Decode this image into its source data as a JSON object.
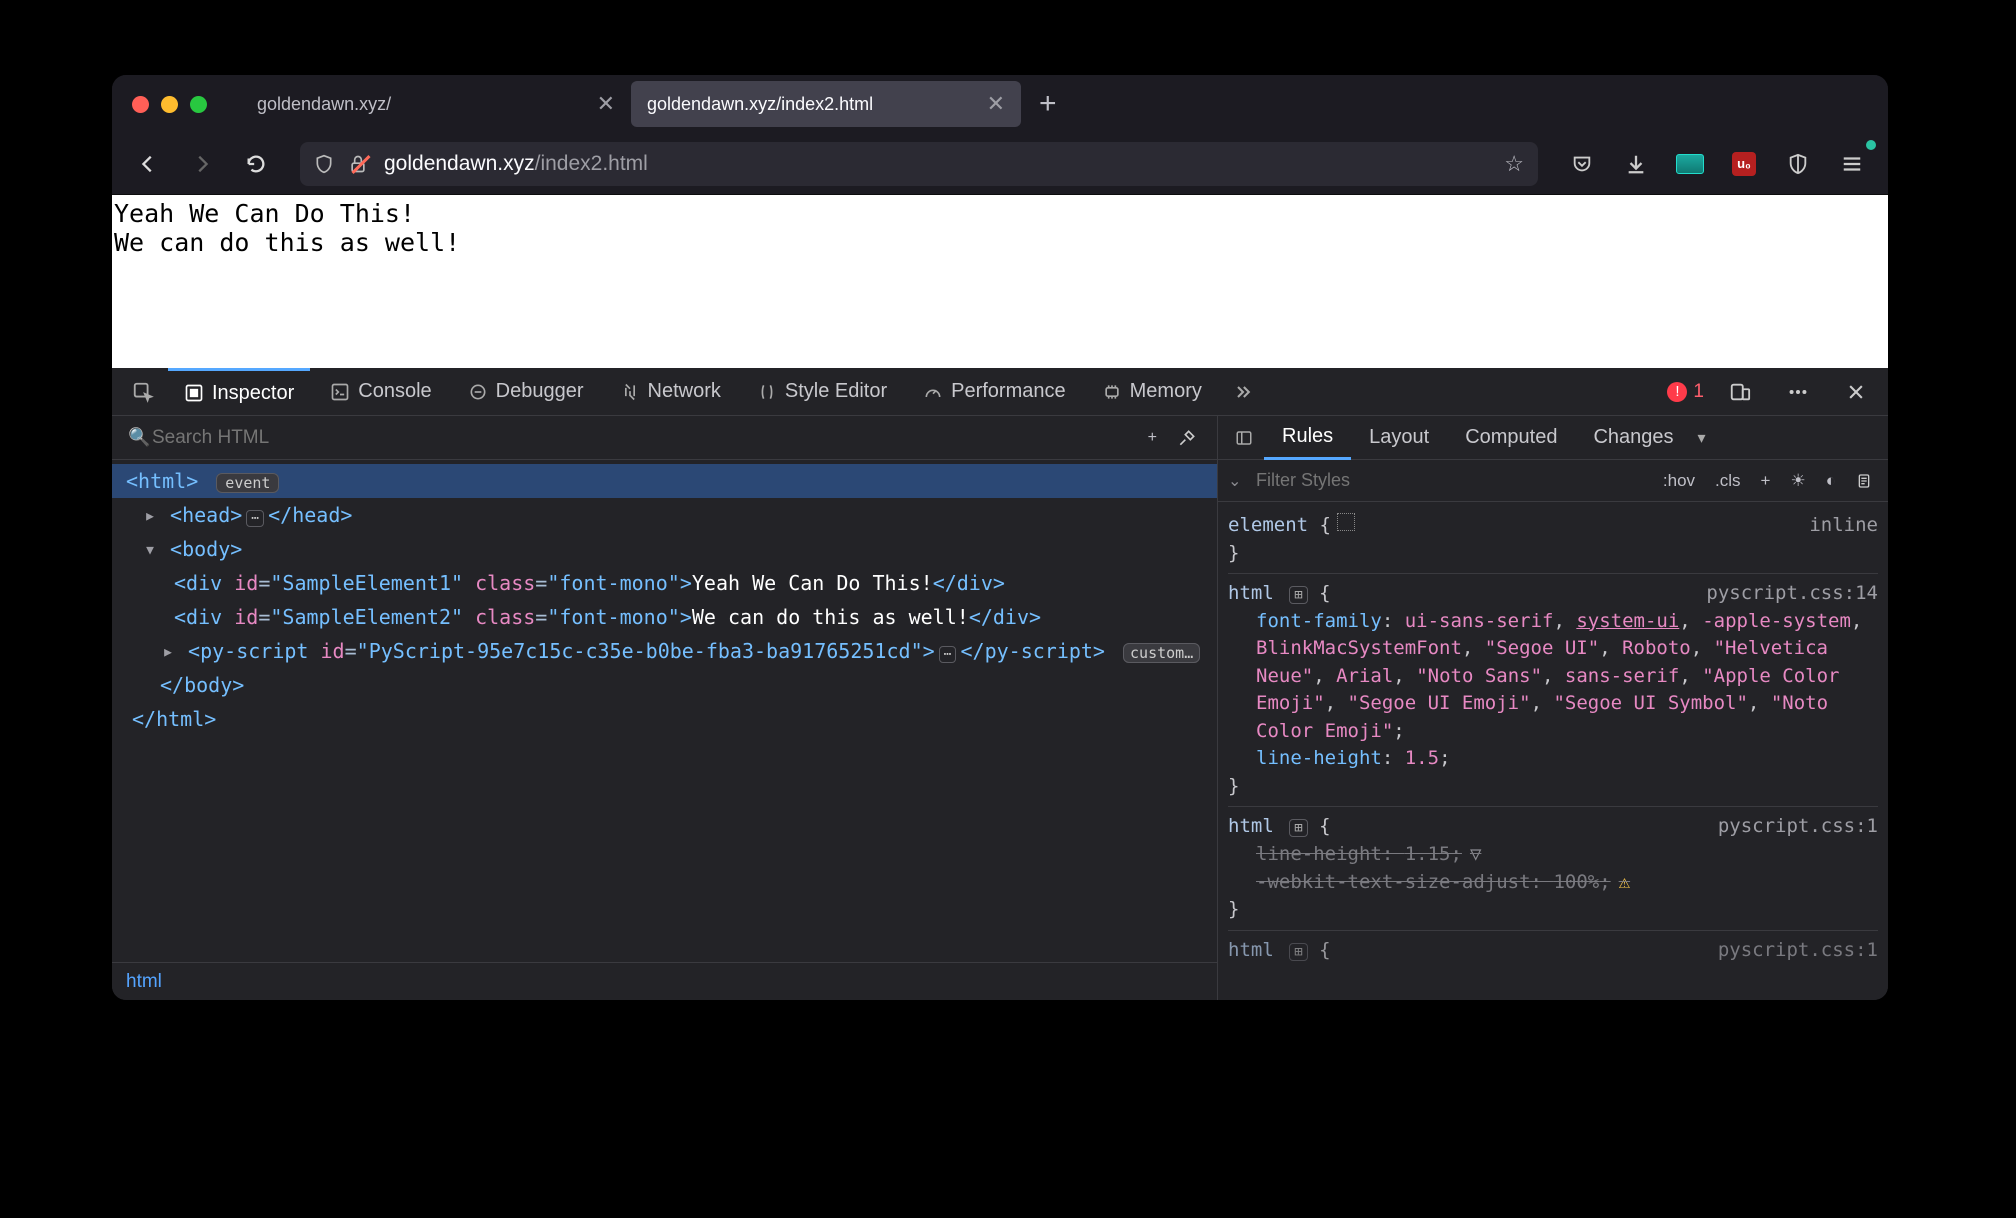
{
  "tabs": [
    {
      "title": "goldendawn.xyz/"
    },
    {
      "title": "goldendawn.xyz/index2.html"
    }
  ],
  "active_tab": 1,
  "url": {
    "host": "goldendawn.xyz",
    "path": "/index2.html"
  },
  "page_lines": [
    "Yeah We Can Do This!",
    "We can do this as well!"
  ],
  "devtools_tabs": [
    "Inspector",
    "Console",
    "Debugger",
    "Network",
    "Style Editor",
    "Performance",
    "Memory"
  ],
  "devtools_active": "Inspector",
  "error_count": "1",
  "search_placeholder": "Search HTML",
  "dom": {
    "html_open": "<html>",
    "event_badge": "event",
    "head": "<head>…</head>",
    "body_open": "<body>",
    "div1_id": "SampleElement1",
    "div1_class": "font-mono",
    "div1_text": "Yeah We Can Do This!",
    "div2_id": "SampleElement2",
    "div2_class": "font-mono",
    "div2_text": "We can do this as well!",
    "py_id": "PyScript-95e7c15c-c35e-b0be-fba3-ba91765251cd",
    "custom_badge": "custom…",
    "body_close": "</body>",
    "html_close": "</html>",
    "ellipsis": "⋯"
  },
  "breadcrumb": "html",
  "rule_tabs": [
    "Rules",
    "Layout",
    "Computed",
    "Changes"
  ],
  "rule_active": "Rules",
  "filter_placeholder": "Filter Styles",
  "hov": ":hov",
  "cls": ".cls",
  "rules": {
    "element": {
      "selector": "element",
      "inline": "inline"
    },
    "htmlRule": {
      "selector": "html",
      "source": "pyscript.css:14",
      "font_family_prop": "font-family",
      "font_family_vals": [
        "ui-sans-serif",
        "system-ui",
        "-apple-system",
        "BlinkMacSystemFont",
        "\"Segoe UI\"",
        "Roboto",
        "\"Helvetica Neue\"",
        "Arial",
        "\"Noto Sans\"",
        "sans-serif",
        "\"Apple Color Emoji\"",
        "\"Segoe UI Emoji\"",
        "\"Segoe UI Symbol\"",
        "\"Noto Color Emoji\""
      ],
      "line_height_prop": "line-height",
      "line_height_val": "1.5"
    },
    "htmlRule2": {
      "selector": "html",
      "source": "pyscript.css:1",
      "line_height_prop": "line-height",
      "line_height_val": "1.15",
      "text_adjust_prop": "-webkit-text-size-adjust",
      "text_adjust_val": "100%"
    },
    "htmlRule3": {
      "selector": "html",
      "source": "pyscript.css:1"
    }
  }
}
